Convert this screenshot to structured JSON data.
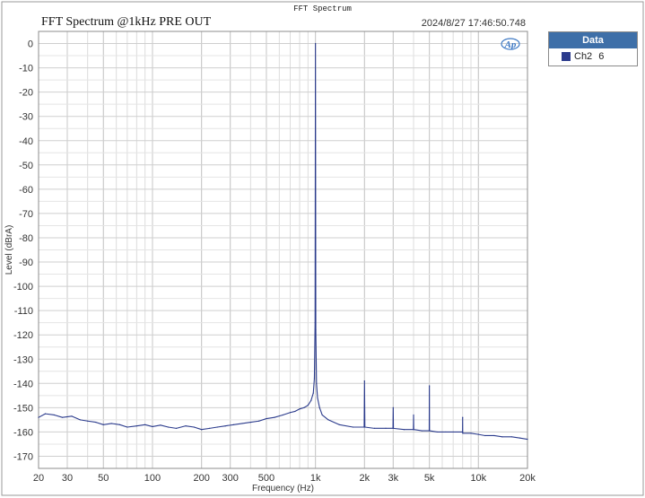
{
  "window_title": "FFT Spectrum",
  "legend": {
    "header": "Data",
    "items": [
      {
        "label": "Ch2",
        "number": "6",
        "color": "#2b3b8c"
      }
    ]
  },
  "chart_data": {
    "type": "line",
    "title": "FFT Spectrum @1kHz PRE OUT",
    "timestamp": "2024/8/27 17:46:50.748",
    "logo_text": "Ap",
    "xlabel": "Frequency (Hz)",
    "ylabel": "Level (dBrA)",
    "xscale": "log",
    "xlim": [
      20,
      20000
    ],
    "ylim": [
      -175,
      5
    ],
    "grid": true,
    "legend_position": "right",
    "x_ticks": [
      20,
      30,
      50,
      100,
      200,
      300,
      500,
      1000,
      2000,
      3000,
      5000,
      10000,
      20000
    ],
    "x_tick_labels": [
      "20",
      "30",
      "50",
      "100",
      "200",
      "300",
      "500",
      "1k",
      "2k",
      "3k",
      "5k",
      "10k",
      "20k"
    ],
    "y_ticks": [
      0,
      -10,
      -20,
      -30,
      -40,
      -50,
      -60,
      -70,
      -80,
      -90,
      -100,
      -110,
      -120,
      -130,
      -140,
      -150,
      -160,
      -170
    ],
    "series": [
      {
        "name": "Ch2",
        "color": "#2b3b8c",
        "x": [
          20,
          22,
          25,
          28,
          32,
          36,
          40,
          45,
          50,
          56,
          63,
          70,
          80,
          90,
          100,
          112,
          125,
          140,
          160,
          180,
          200,
          224,
          250,
          280,
          315,
          355,
          400,
          450,
          500,
          560,
          630,
          700,
          750,
          800,
          850,
          900,
          940,
          970,
          985,
          995,
          1000,
          1005,
          1015,
          1030,
          1060,
          1100,
          1200,
          1400,
          1700,
          1990,
          2000,
          2010,
          2300,
          2700,
          2990,
          3000,
          3010,
          3500,
          3990,
          4000,
          4010,
          4500,
          4990,
          5000,
          5010,
          5600,
          6300,
          7000,
          7990,
          8000,
          8010,
          9000,
          10000,
          11000,
          12500,
          14000,
          16000,
          18000,
          20000
        ],
        "y": [
          -154,
          -152.5,
          -153,
          -154,
          -153.5,
          -155,
          -155.5,
          -156,
          -157,
          -156.5,
          -157,
          -158,
          -157.5,
          -157,
          -157.8,
          -157.2,
          -158,
          -158.5,
          -157.5,
          -158,
          -159,
          -158.5,
          -158,
          -157.5,
          -157,
          -156.5,
          -156,
          -155.5,
          -154.5,
          -154,
          -153,
          -152,
          -151.5,
          -150.5,
          -150,
          -149,
          -147,
          -144,
          -138,
          -115,
          0,
          -118,
          -140,
          -146,
          -150,
          -153,
          -155,
          -157,
          -158,
          -158,
          -139,
          -158,
          -158.5,
          -158.5,
          -158.5,
          -150,
          -158.5,
          -159,
          -159,
          -153,
          -159,
          -159.5,
          -159.5,
          -141,
          -159.5,
          -160,
          -160,
          -160,
          -160,
          -154,
          -160.5,
          -160.5,
          -161,
          -161.5,
          -161.5,
          -162,
          -162,
          -162.5,
          -163
        ]
      }
    ]
  }
}
